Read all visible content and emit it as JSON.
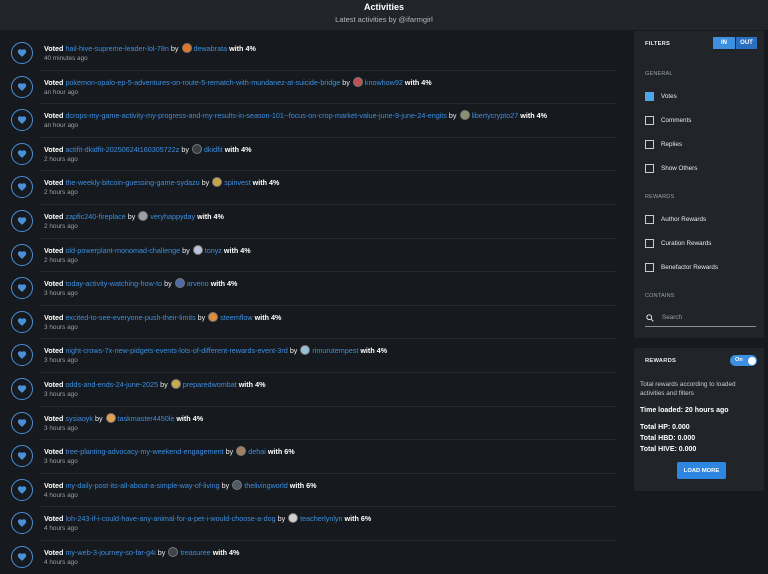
{
  "header": {
    "title": "Activities",
    "subtitle": "Latest activities by @ifarmgirl"
  },
  "activities": [
    {
      "verb": "Voted",
      "permlink": "hail-hive-supreme-leader-lol-78n",
      "by": "by",
      "author": "dewabrata",
      "weight": "with 4%",
      "time": "40 minutes ago",
      "avatar_color": "#e0762a"
    },
    {
      "verb": "Voted",
      "permlink": "pokemon-opalo-ep-5-adventures-on-route-5-rematch-with-mundanez-at-suicide-bridge",
      "by": "by",
      "author": "knowhow92",
      "weight": "with 4%",
      "time": "an hour ago",
      "avatar_color": "#c0504d"
    },
    {
      "verb": "Voted",
      "permlink": "dcrops-my-game-activity-my-progress-and-my-results-in-season-101--focus-on-crop-market-value-june-9-june-24-engits",
      "by": "by",
      "author": "libertycrypto27",
      "weight": "with 4%",
      "time": "an hour ago",
      "avatar_color": "#8a8f70"
    },
    {
      "verb": "Voted",
      "permlink": "actifit-dkidfit-20250624t160305722z",
      "by": "by",
      "author": "dkidfit",
      "weight": "with 4%",
      "time": "2 hours ago",
      "avatar_color": "#3a3f44"
    },
    {
      "verb": "Voted",
      "permlink": "the-weekly-bitcoin-guessing-game-sydazu",
      "by": "by",
      "author": "spinvest",
      "weight": "with 4%",
      "time": "2 hours ago",
      "avatar_color": "#c9a14a"
    },
    {
      "verb": "Voted",
      "permlink": "zapfic240-fireplace",
      "by": "by",
      "author": "veryhappyday",
      "weight": "with 4%",
      "time": "2 hours ago",
      "avatar_color": "#9aa0a6"
    },
    {
      "verb": "Voted",
      "permlink": "old-powerplant-monomad-challenge",
      "by": "by",
      "author": "tonyz",
      "weight": "with 4%",
      "time": "2 hours ago",
      "avatar_color": "#b9c2d8"
    },
    {
      "verb": "Voted",
      "permlink": "today-activity-watching-how-to",
      "by": "by",
      "author": "arveno",
      "weight": "with 4%",
      "time": "3 hours ago",
      "avatar_color": "#4d6ba8"
    },
    {
      "verb": "Voted",
      "permlink": "excited-to-see-everyone-push-their-limits",
      "by": "by",
      "author": "steemflow",
      "weight": "with 4%",
      "time": "3 hours ago",
      "avatar_color": "#e08a3a"
    },
    {
      "verb": "Voted",
      "permlink": "night-crows-7x-new-pidgets-events-lots-of-different-rewards-event-3rd",
      "by": "by",
      "author": "rimurutempest",
      "weight": "with 4%",
      "time": "3 hours ago",
      "avatar_color": "#9ac0d8"
    },
    {
      "verb": "Voted",
      "permlink": "odds-and-ends-24-june-2025",
      "by": "by",
      "author": "preparedwombat",
      "weight": "with 4%",
      "time": "3 hours ago",
      "avatar_color": "#c8a850"
    },
    {
      "verb": "Voted",
      "permlink": "sysiaoyk",
      "by": "by",
      "author": "taskmaster4450le",
      "weight": "with 4%",
      "time": "3 hours ago",
      "avatar_color": "#e0a050"
    },
    {
      "verb": "Voted",
      "permlink": "tree-planting-advocacy-my-weekend-engagement",
      "by": "by",
      "author": "dehai",
      "weight": "with 6%",
      "time": "3 hours ago",
      "avatar_color": "#a08060"
    },
    {
      "verb": "Voted",
      "permlink": "my-daily-post-its-all-about-a-simple-way-of-living",
      "by": "by",
      "author": "thelivingworld",
      "weight": "with 6%",
      "time": "4 hours ago",
      "avatar_color": "#505860"
    },
    {
      "verb": "Voted",
      "permlink": "loh-243-if-i-could-have-any-animal-for-a-pet-i-would-choose-a-dog",
      "by": "by",
      "author": "teacherlynlyn",
      "weight": "with 6%",
      "time": "4 hours ago",
      "avatar_color": "#d0d0d0"
    },
    {
      "verb": "Voted",
      "permlink": "my-web-3-journey-so-far-g4i",
      "by": "by",
      "author": "treasuree",
      "weight": "with 4%",
      "time": "4 hours ago",
      "avatar_color": "#404448"
    }
  ],
  "filters": {
    "title": "FILTERS",
    "toggle_in": "IN",
    "toggle_out": "OUT",
    "general_label": "GENERAL",
    "general": [
      "Votes",
      "Comments",
      "Replies",
      "Show Others"
    ],
    "rewards_label": "REWARDS",
    "rewards": [
      "Author Rewards",
      "Curation Rewards",
      "Benefactor Rewards"
    ],
    "contains_label": "CONTAINS",
    "search_placeholder": "Search"
  },
  "rewards": {
    "title": "REWARDS",
    "switch_label": "On",
    "description": "Total rewards according to loaded activities and filters",
    "time_loaded": "Time loaded: 20 hours ago",
    "total_hp": "Total HP: 0.000",
    "total_hbd": "Total HBD: 0.000",
    "total_hive": "Total HIVE: 0.000",
    "load_more": "LOAD MORE"
  },
  "colors": {
    "accent": "#3d8fe0",
    "background": "#16191d",
    "panel": "#212529"
  }
}
